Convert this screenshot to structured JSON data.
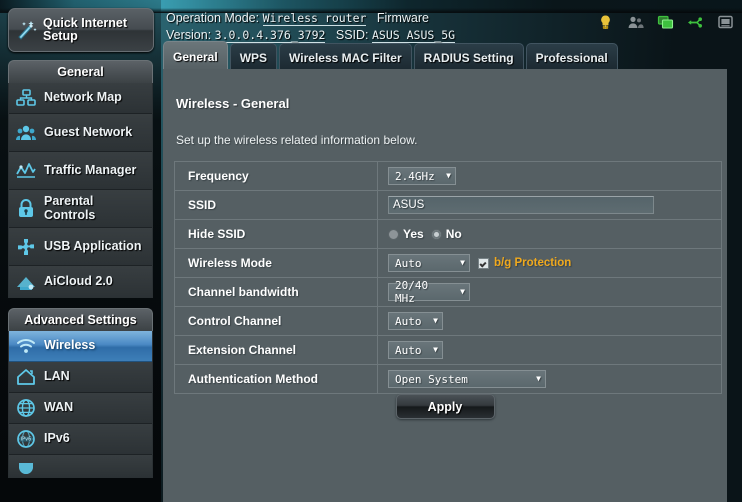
{
  "header": {
    "operation_mode_label": "Operation Mode:",
    "operation_mode_value": "Wireless router",
    "firmware_label": "Firmware",
    "version_label": "Version:",
    "version_value": "3.0.0.4.376_3792",
    "ssid_label": "SSID:",
    "ssid_value": "ASUS ASUS_5G",
    "icons": [
      {
        "name": "notification-bulb-icon",
        "color": "#e8c23a"
      },
      {
        "name": "clients-users-icon",
        "color": "#8a9296"
      },
      {
        "name": "network-monitors-icon",
        "color": "#3ec13e"
      },
      {
        "name": "usb-device-icon",
        "color": "#3ec13e"
      },
      {
        "name": "printer-icon",
        "color": "#8a9296"
      }
    ]
  },
  "sidebar": {
    "quick_setup": {
      "label": "Quick Internet Setup",
      "icon": "magic-wand-icon"
    },
    "groups": [
      {
        "title": "General",
        "items": [
          {
            "label": "Network Map",
            "icon": "network-map-icon",
            "active": false
          },
          {
            "label": "Guest Network",
            "icon": "guest-network-icon",
            "active": false
          },
          {
            "label": "Traffic Manager",
            "icon": "traffic-manager-icon",
            "active": false
          },
          {
            "label": "Parental Controls",
            "icon": "parental-controls-icon",
            "active": false
          },
          {
            "label": "USB Application",
            "icon": "usb-application-icon",
            "active": false
          },
          {
            "label": "AiCloud 2.0",
            "icon": "aicloud-icon",
            "active": false
          }
        ]
      },
      {
        "title": "Advanced Settings",
        "items": [
          {
            "label": "Wireless",
            "icon": "wireless-icon",
            "active": true
          },
          {
            "label": "LAN",
            "icon": "lan-home-icon",
            "active": false
          },
          {
            "label": "WAN",
            "icon": "wan-globe-icon",
            "active": false
          },
          {
            "label": "IPv6",
            "icon": "ipv6-globe-icon",
            "active": false
          }
        ]
      }
    ]
  },
  "tabs": [
    {
      "label": "General",
      "active": true
    },
    {
      "label": "WPS",
      "active": false
    },
    {
      "label": "Wireless MAC Filter",
      "active": false
    },
    {
      "label": "RADIUS Setting",
      "active": false
    },
    {
      "label": "Professional",
      "active": false
    }
  ],
  "content": {
    "title": "Wireless - General",
    "description": "Set up the wireless related information below.",
    "rows": {
      "frequency": {
        "label": "Frequency",
        "value": "2.4GHz"
      },
      "ssid": {
        "label": "SSID",
        "value": "ASUS",
        "placeholder": ""
      },
      "hide_ssid": {
        "label": "Hide SSID",
        "yes": "Yes",
        "no": "No",
        "selected": "No"
      },
      "wireless_mode": {
        "label": "Wireless Mode",
        "value": "Auto",
        "protection_label": "b/g Protection",
        "protection_checked": true
      },
      "channel_bandwidth": {
        "label": "Channel bandwidth",
        "value": "20/40 MHz"
      },
      "control_channel": {
        "label": "Control Channel",
        "value": "Auto"
      },
      "extension_channel": {
        "label": "Extension Channel",
        "value": "Auto"
      },
      "authentication_method": {
        "label": "Authentication Method",
        "value": "Open System"
      }
    },
    "apply_label": "Apply"
  },
  "colors": {
    "panel": "#555f63",
    "accent_blue": "#4a89c4",
    "accent_orange": "#f0a91e",
    "icon_cyan": "#5ec8e8"
  }
}
